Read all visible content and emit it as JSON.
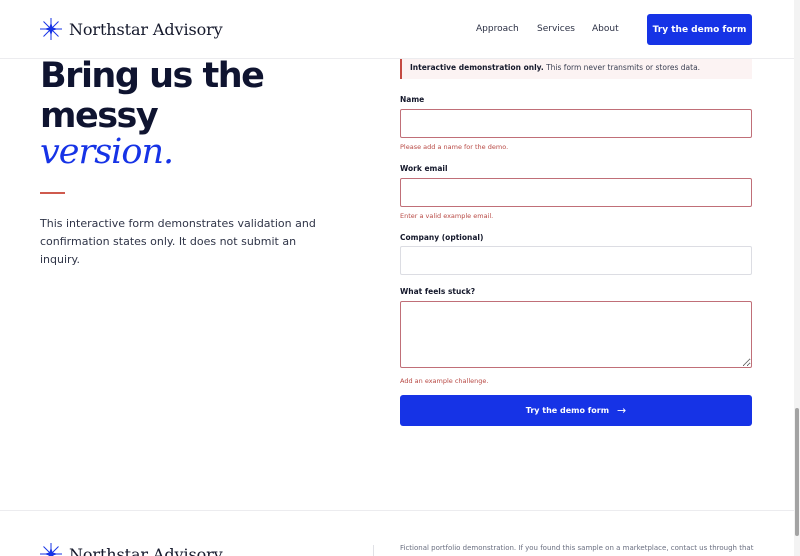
{
  "brand": {
    "name": "Northstar Advisory",
    "icon": "compass-star-icon",
    "accent": "#1633e6"
  },
  "nav": {
    "links": [
      "Approach",
      "Services",
      "About"
    ],
    "cta_label": "Try the demo form"
  },
  "hero": {
    "line1": "Bring us the",
    "line2": "messy",
    "line3": "version.",
    "intro": "This interactive form demonstrates validation and confirmation states only. It does not submit an inquiry."
  },
  "form": {
    "notice_bold": "Interactive demonstration only.",
    "notice_rest": " This form never transmits or stores data.",
    "name": {
      "label": "Name",
      "value": "",
      "error": "Please add a name for the demo."
    },
    "email": {
      "label": "Work email",
      "value": "",
      "error": "Enter a valid example email."
    },
    "company": {
      "label": "Company (optional)",
      "value": ""
    },
    "stuck": {
      "label": "What feels stuck?",
      "value": "",
      "error": "Add an example challenge."
    },
    "submit_label": "Try the demo form",
    "submit_icon": "arrow-right-icon"
  },
  "footer": {
    "brand_name": "Northstar Advisory",
    "text": "Fictional portfolio demonstration. If you found this sample on a marketplace, contact us through that"
  },
  "colors": {
    "error": "#b84a45",
    "error_border": "#c06f78",
    "notice_bg": "#fcf3f3",
    "rule": "#cf5a4e"
  }
}
